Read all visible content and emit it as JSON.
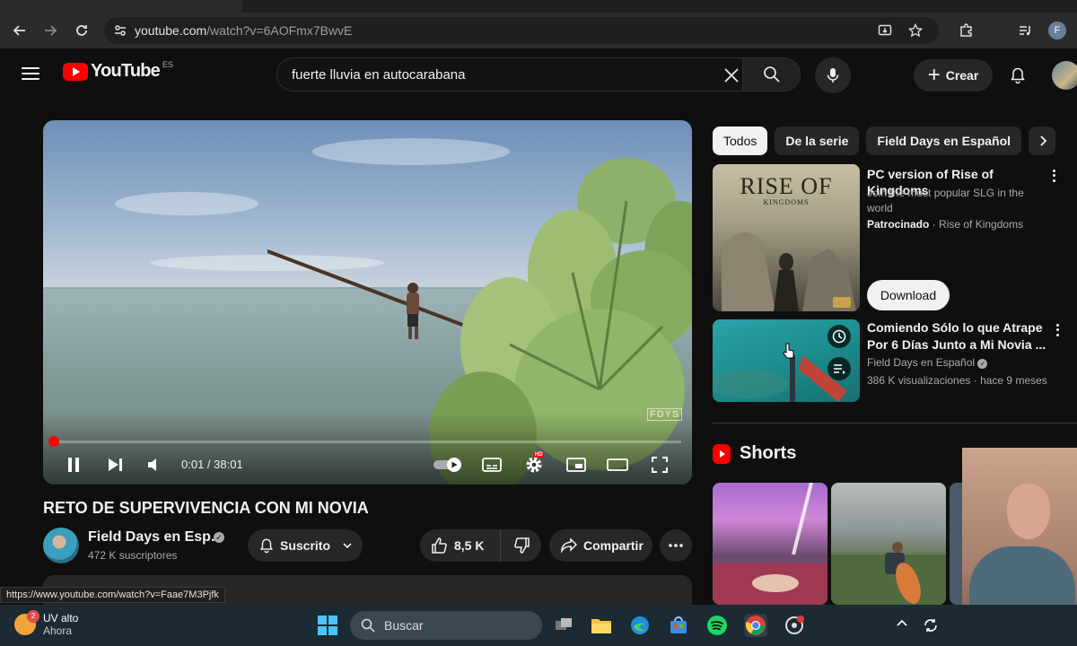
{
  "browser": {
    "url_host": "youtube.com",
    "url_path": "/watch?v=6AOFmx7BwvE",
    "profile_initial": "F",
    "status_url": "https://www.youtube.com/watch?v=Faae7M3Pjfk"
  },
  "header": {
    "logo_text": "YouTube",
    "country_code": "ES",
    "search_value": "fuerte lluvia en autocarabana",
    "create_label": "Crear"
  },
  "player": {
    "watermark": "FDYS",
    "time": "0:01 / 38:01",
    "progress": 0.0004,
    "hd_badge": "HD"
  },
  "video": {
    "title": "RETO DE SUPERVIVENCIA CON MI NOVIA",
    "channel": "Field Days en Esp...",
    "subscribers": "472 K suscriptores",
    "subscribed_label": "Suscrito",
    "likes": "8,5 K",
    "share_label": "Compartir"
  },
  "chips": [
    "Todos",
    "De la serie",
    "Field Days en Español"
  ],
  "ad": {
    "thumb_title": "RISE OF",
    "thumb_subtitle": "KINGDOMS",
    "title": "PC version of Rise of Kingdoms",
    "description": "Join the most popular SLG in the world",
    "sponsored": "Patrocinado",
    "advertiser": "Rise of Kingdoms",
    "cta": "Download"
  },
  "related": [
    {
      "title": "Comiendo Sólo lo que Atrape Por 6 Días Junto a Mi Novia ...",
      "channel": "Field Days en Español",
      "views": "386 K visualizaciones",
      "age": "hace 9 meses"
    }
  ],
  "shorts": {
    "title": "Shorts"
  },
  "taskbar": {
    "weather_title": "UV alto",
    "weather_sub": "Ahora",
    "weather_badge": "2",
    "search_label": "Buscar"
  },
  "colors": {
    "accent": "#ff0000",
    "background": "#0f0f0f",
    "surface": "#272727"
  }
}
